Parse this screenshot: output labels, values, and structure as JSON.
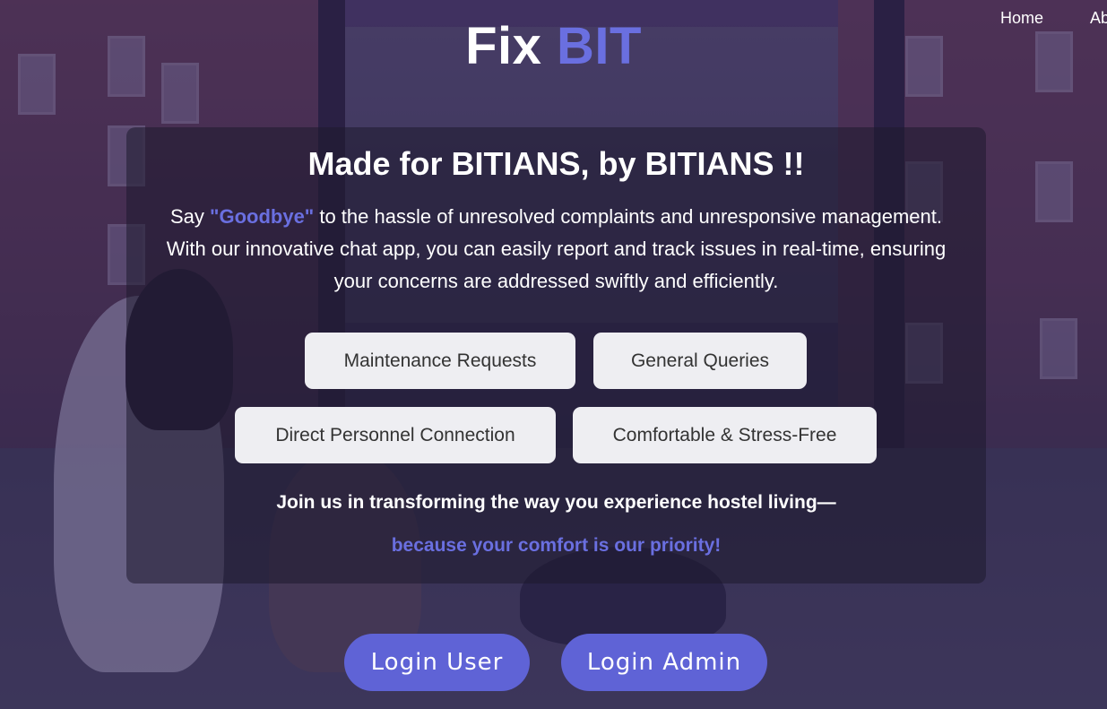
{
  "nav": {
    "items": [
      "Home",
      "Ab"
    ]
  },
  "logo": {
    "text_main": "Fix",
    "text_accent": "BIT"
  },
  "hero": {
    "heading": "Made for BITIANS, by BITIANS !!",
    "desc_prefix": "Say ",
    "desc_highlight": "\"Goodbye\"",
    "desc_rest": " to the hassle of unresolved complaints and unresponsive management. With our innovative chat app, you can easily report and track issues in real-time, ensuring your concerns are addressed swiftly and efficiently."
  },
  "features": [
    "Maintenance Requests",
    "General Queries",
    "Direct Personnel Connection",
    "Comfortable & Stress-Free"
  ],
  "join_text": "Join us in transforming the way you experience hostel living—",
  "priority_text": "because your comfort is our priority!",
  "login": {
    "user_label": "Login User",
    "admin_label": "Login Admin"
  },
  "colors": {
    "accent": "#6a6fe0",
    "button": "#5f63d6",
    "feature_bg": "#eeeef2"
  }
}
